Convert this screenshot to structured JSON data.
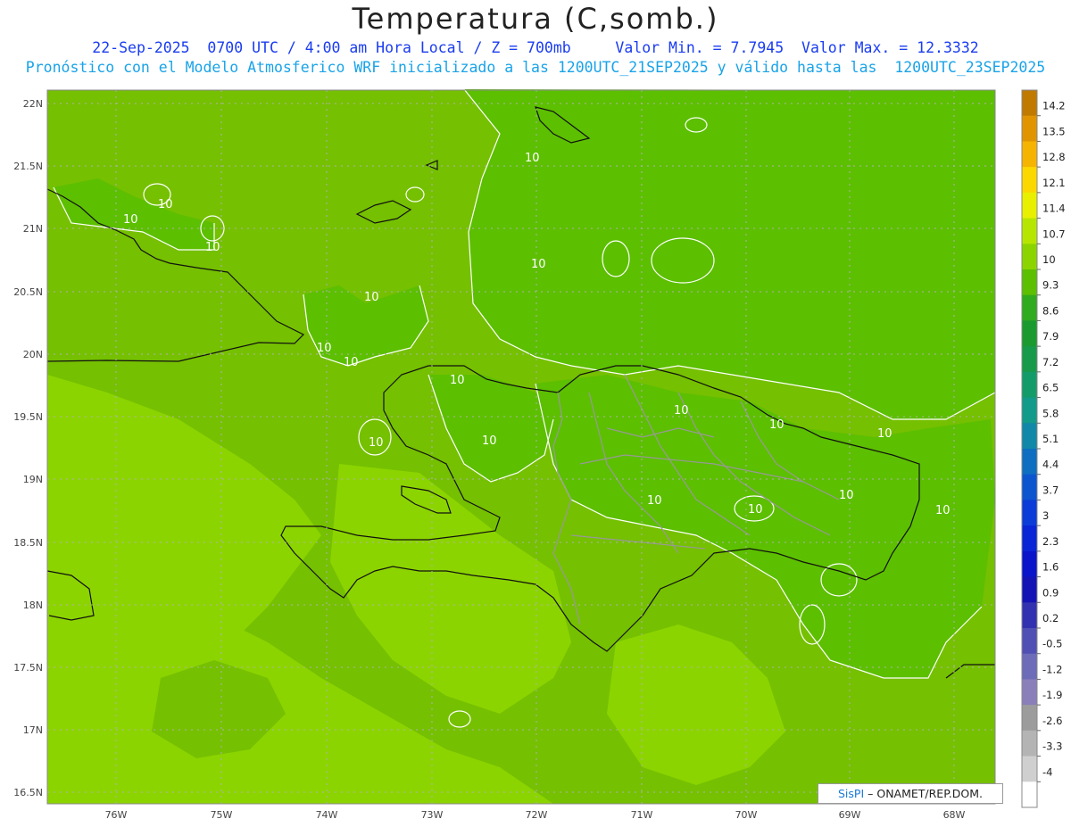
{
  "header": {
    "title": "Temperatura (C,somb.)",
    "line1": "22-Sep-2025  0700 UTC / 4:00 am Hora Local / Z = 700mb     Valor Min. = 7.7945  Valor Max. = 12.3332",
    "line2": "Pronóstico con el Modelo Atmosferico WRF inicializado a las 1200UTC_21SEP2025 y válido hasta las  1200UTC_23SEP2025"
  },
  "axes": {
    "lat_labels": [
      "22N",
      "21.5N",
      "21N",
      "20.5N",
      "20N",
      "19.5N",
      "19N",
      "18.5N",
      "18N",
      "17.5N",
      "17N",
      "16.5N"
    ],
    "lon_labels": [
      "76W",
      "75W",
      "74W",
      "73W",
      "72W",
      "71W",
      "70W",
      "69W",
      "68W"
    ]
  },
  "contour_labels": [
    "10",
    "10",
    "10",
    "10",
    "10",
    "10",
    "10",
    "10",
    "10",
    "10",
    "10",
    "10",
    "10",
    "10",
    "10",
    "10",
    "10",
    "10"
  ],
  "colorbar": {
    "levels": [
      "14.2",
      "13.5",
      "12.8",
      "12.1",
      "11.4",
      "10.7",
      "10",
      "9.3",
      "8.6",
      "7.9",
      "7.2",
      "6.5",
      "5.8",
      "5.1",
      "4.4",
      "3.7",
      "3",
      "2.3",
      "1.6",
      "0.9",
      "0.2",
      "-0.5",
      "-1.2",
      "-1.9",
      "-2.6",
      "-3.3",
      "-4"
    ],
    "colors": [
      "#c07a00",
      "#e09500",
      "#f5b400",
      "#fbd800",
      "#e8f000",
      "#b6e600",
      "#8cd400",
      "#5cbf00",
      "#30aa1f",
      "#1b9a30",
      "#179a4a",
      "#139c69",
      "#129a8a",
      "#1188a8",
      "#0e6ec0",
      "#0c55cf",
      "#0b3cd8",
      "#0a25d6",
      "#0a14c8",
      "#1414b4",
      "#3232b0",
      "#5050b4",
      "#6c6cb8",
      "#8a7fb8",
      "#9c9c9c",
      "#b4b4b4",
      "#cfcfcf",
      "#ffffff"
    ]
  },
  "credit": {
    "brand": "SisPI",
    "text": " – ONAMET/REP.DOM."
  }
}
